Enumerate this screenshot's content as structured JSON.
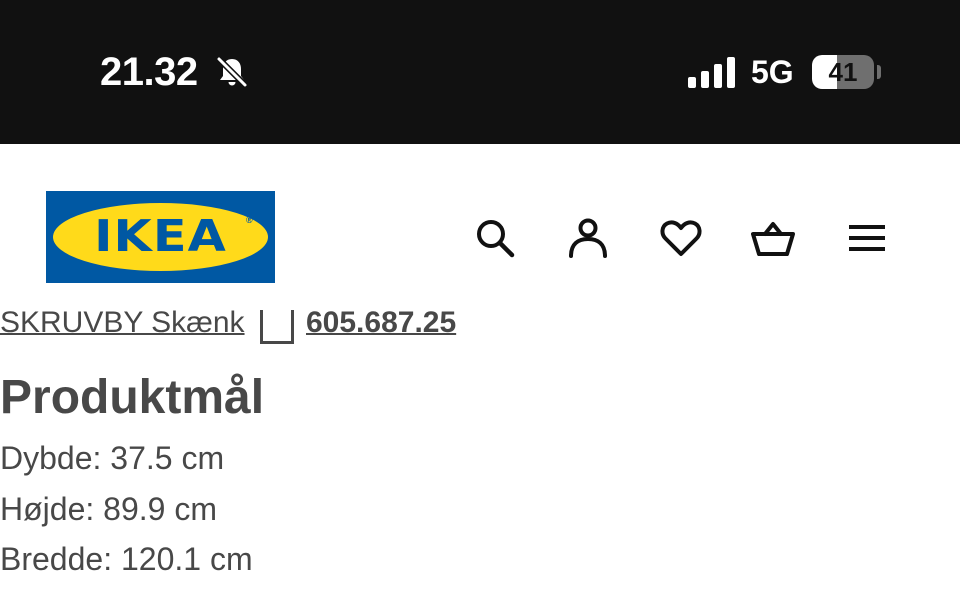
{
  "status_bar": {
    "time": "21.32",
    "network": "5G",
    "battery_level": "41",
    "battery_fraction": 0.41,
    "icons": [
      "bell-muted-icon",
      "signal-icon"
    ]
  },
  "header": {
    "logo_text": "IKEA",
    "logo_reg": "®",
    "logo_colors": {
      "blue": "#0058a3",
      "yellow": "#ffda1a"
    },
    "icons": [
      "search-icon",
      "account-icon",
      "heart-icon",
      "basket-icon",
      "menu-icon"
    ]
  },
  "breadcrumb": {
    "link": "SKRUVBY Skænk",
    "article_number": "605.687.25"
  },
  "product_dimensions": {
    "title": "Produktmål",
    "rows": [
      "Dybde: 37.5 cm",
      "Højde: 89.9 cm",
      "Bredde: 120.1 cm"
    ]
  }
}
